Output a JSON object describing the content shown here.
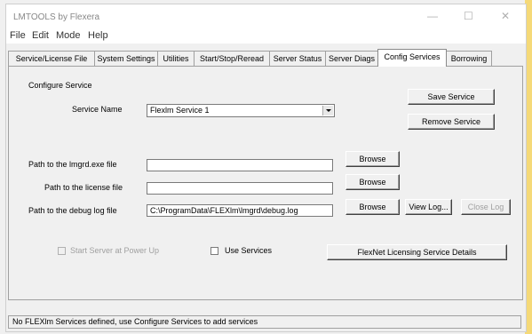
{
  "window": {
    "title": "LMTOOLS by Flexera",
    "minimize_glyph": "—",
    "maximize_glyph": "☐",
    "close_glyph": "✕"
  },
  "menu": [
    "File",
    "Edit",
    "Mode",
    "Help"
  ],
  "tabs": [
    {
      "label": "Service/License File"
    },
    {
      "label": "System Settings"
    },
    {
      "label": "Utilities"
    },
    {
      "label": "Start/Stop/Reread"
    },
    {
      "label": "Server Status"
    },
    {
      "label": "Server Diags"
    },
    {
      "label": "Config Services",
      "active": true
    },
    {
      "label": "Borrowing"
    }
  ],
  "config": {
    "group_label": "Configure Service",
    "service_name_label": "Service Name",
    "service_name_value": "Flexlm Service 1",
    "save_button": "Save Service",
    "remove_button": "Remove Service",
    "lmgrd_label": "Path to the lmgrd.exe file",
    "lmgrd_value": "",
    "license_label": "Path to the license file",
    "license_value": "",
    "debug_label": "Path to the debug log file",
    "debug_value": "C:\\ProgramData\\FLEXlm\\lmgrd\\debug.log",
    "browse_button": "Browse",
    "view_log_button": "View Log...",
    "close_log_button": "Close Log",
    "start_server_label": "Start Server at Power Up",
    "use_services_label": "Use Services",
    "flexnet_details_button": "FlexNet Licensing Service Details"
  },
  "status_text": "No FLEXlm Services defined, use Configure Services to add services"
}
